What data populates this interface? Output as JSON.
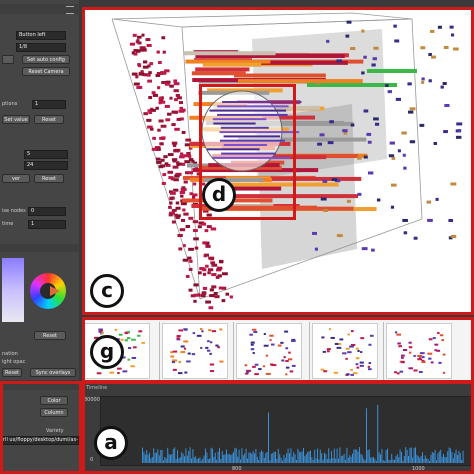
{
  "left_panel": {
    "top": {
      "dropdown_value": "Button left",
      "number_value": "1/8",
      "setup_config_label": "Set auto config",
      "reset_camera_label": "Reset Camera",
      "options_label": "ptions",
      "options_value": "1",
      "set_value_label": "Set value",
      "reset_label": "Reset",
      "field_a": "5",
      "field_b": "24",
      "btn_left": "ver",
      "btn_right": "Reset",
      "partial_label_1": "ise nodes",
      "partial_value_1": "0",
      "partial_label_2": "time",
      "partial_value_2": "1"
    },
    "color": {
      "reset_label": "Reset",
      "label_1": "nation",
      "label_2": "ight opac",
      "reset_bottom_label": "Reset",
      "sync_label": "Sync overlays"
    },
    "bottom": {
      "color_label": "Color",
      "column_label": "Column",
      "variety_label": "Variety",
      "path_text": "rll ux/floppy/desktop/dumi/ax-State"
    }
  },
  "callouts": {
    "a": "a",
    "c": "c",
    "d": "d",
    "g": "g"
  },
  "timeline": {
    "title": "Timeline",
    "y_top_label": "80000",
    "y_bottom_label": "0",
    "x_labels": [
      "800",
      "1000"
    ],
    "bar_color": "#3a8fd6"
  },
  "colors": {
    "highlight": "#d01a1a",
    "background": "#3a3a3a"
  }
}
